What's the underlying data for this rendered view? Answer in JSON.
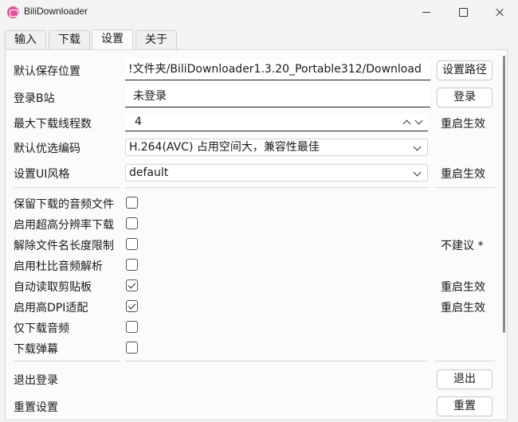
{
  "window": {
    "title": "BiliDownloader"
  },
  "tabs": [
    {
      "label": "输入"
    },
    {
      "label": "下载"
    },
    {
      "label": "设置"
    },
    {
      "label": "关于"
    }
  ],
  "settings": {
    "save_path": {
      "label": "默认保存位置",
      "value": "!文件夹/BiliDownloader1.3.20_Portable312/Download",
      "button": "设置路径"
    },
    "login": {
      "label": "登录B站",
      "value": "未登录",
      "button": "登录"
    },
    "threads": {
      "label": "最大下载线程数",
      "value": "4",
      "note": "重启生效"
    },
    "codec": {
      "label": "默认优选编码",
      "value": "H.264(AVC) 占用空间大，兼容性最佳"
    },
    "ui_style": {
      "label": "设置UI风格",
      "value": "default",
      "note": "重启生效"
    },
    "checkboxes": [
      {
        "label": "保留下载的音频文件",
        "checked": false,
        "note": ""
      },
      {
        "label": "启用超高分辨率下载",
        "checked": false,
        "note": ""
      },
      {
        "label": "解除文件名长度限制",
        "checked": false,
        "note": "不建议 *"
      },
      {
        "label": "启用杜比音频解析",
        "checked": false,
        "note": ""
      },
      {
        "label": "自动读取剪贴板",
        "checked": true,
        "note": "重启生效"
      },
      {
        "label": "启用高DPI适配",
        "checked": true,
        "note": "重启生效"
      },
      {
        "label": "仅下载音频",
        "checked": false,
        "note": ""
      },
      {
        "label": "下载弹幕",
        "checked": false,
        "note": ""
      }
    ],
    "logout": {
      "label": "退出登录",
      "button": "退出"
    },
    "reset": {
      "label": "重置设置",
      "button": "重置"
    }
  },
  "colors": {
    "accent_icon": "#e0559a"
  }
}
